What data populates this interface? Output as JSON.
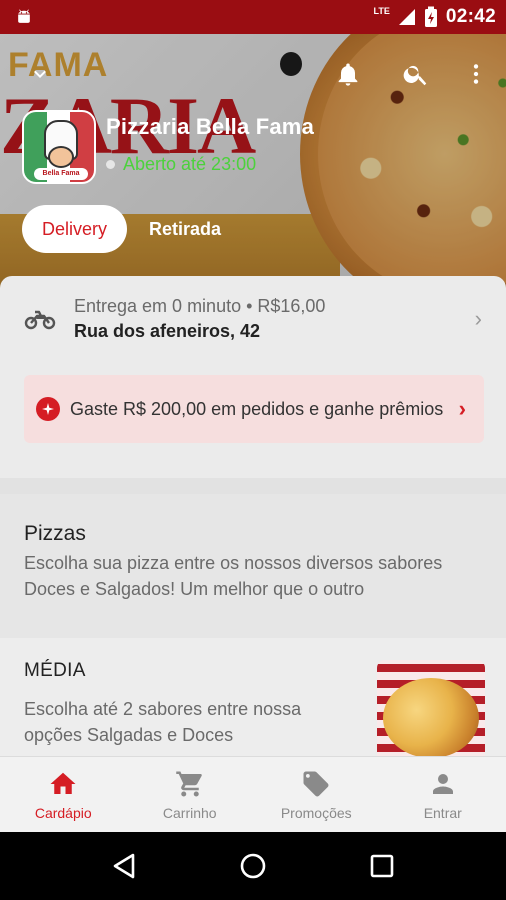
{
  "status_bar": {
    "time": "02:42",
    "network": "LTE",
    "icons": [
      "android-icon",
      "signal-icon",
      "battery-charging-icon"
    ]
  },
  "hero": {
    "background_text_top": "FAMA",
    "background_text_main": "ZARIA",
    "store_name": "Pizzaria Bella Fama",
    "open_status": "Aberto até 23:00",
    "logo_text": "Bella Fama",
    "icons": [
      "chevron-down-icon",
      "bell-icon",
      "search-icon",
      "more-vertical-icon"
    ]
  },
  "mode_tabs": {
    "active": "Delivery",
    "inactive": "Retirada"
  },
  "delivery": {
    "line1": "Entrega em 0 minuto • R$16,00",
    "address": "Rua dos afeneiros, 42"
  },
  "promo": {
    "text": "Gaste R$ 200,00 em pedidos e ganhe prêmios"
  },
  "category": {
    "title": "Pizzas",
    "description": "Escolha sua pizza entre os nossos diversos sabores Doces e Salgados! Um melhor que o outro"
  },
  "product": {
    "name": "MÉDIA",
    "description": "Escolha até 2 sabores entre nossa opções Salgadas e Doces"
  },
  "bottom_nav": {
    "items": [
      {
        "label": "Cardápio",
        "icon": "home-icon",
        "active": true
      },
      {
        "label": "Carrinho",
        "icon": "cart-icon",
        "active": false
      },
      {
        "label": "Promoções",
        "icon": "tag-icon",
        "active": false
      },
      {
        "label": "Entrar",
        "icon": "person-icon",
        "active": false
      }
    ]
  },
  "colors": {
    "status_bar": "#9a0d12",
    "accent": "#d51d24",
    "open_green": "#4cd13c",
    "promo_bg": "#f6dede"
  }
}
